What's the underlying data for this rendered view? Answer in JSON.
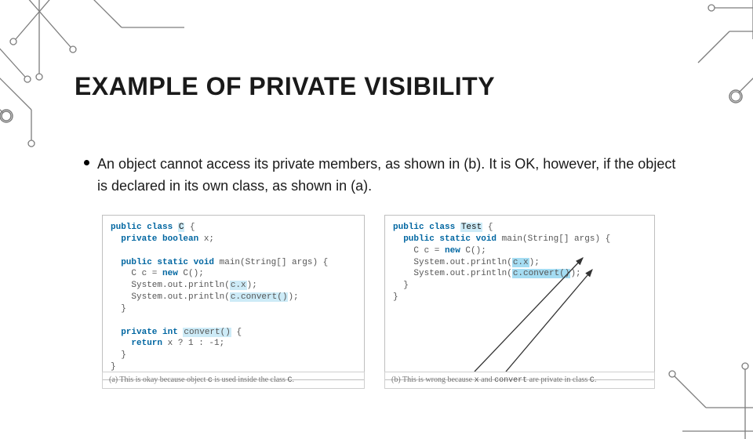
{
  "title": "EXAMPLE OF PRIVATE VISIBILITY",
  "bullet": "An object cannot access its private members, as shown in (b). It is OK, however, if the object is declared in its own class, as shown in (a).",
  "code_a": {
    "lines": [
      {
        "t": "public class ",
        "k": true,
        "after": "C",
        "cls": true,
        "rest": " {"
      },
      {
        "indent": 1,
        "t": "private boolean ",
        "k": true,
        "after": "x;"
      },
      {
        "blank": true
      },
      {
        "indent": 1,
        "t": "public static void ",
        "k": true,
        "after": "main(String[] args) {"
      },
      {
        "indent": 2,
        "plain": "C c = ",
        "k2": "new ",
        "after2": "C();"
      },
      {
        "indent": 2,
        "plain": "System.out.println(",
        "hl": "c.x",
        "rest": ");"
      },
      {
        "indent": 2,
        "plain": "System.out.println(",
        "hl": "c.convert()",
        "rest": ");"
      },
      {
        "indent": 1,
        "plain": "}"
      },
      {
        "blank": true
      },
      {
        "indent": 1,
        "t": "private int ",
        "k": true,
        "hl": "convert()",
        "rest": " {"
      },
      {
        "indent": 2,
        "t": "return ",
        "k": true,
        "after": "x ? 1 : -1;"
      },
      {
        "indent": 1,
        "plain": "}"
      },
      {
        "plain": "}"
      }
    ]
  },
  "code_b": {
    "lines": [
      {
        "t": "public class ",
        "k": true,
        "after": "Test",
        "cls": true,
        "rest": " {"
      },
      {
        "indent": 1,
        "t": "public static void ",
        "k": true,
        "after": "main(String[] args) {"
      },
      {
        "indent": 2,
        "plain": "C c = ",
        "k2": "new ",
        "after2": "C();"
      },
      {
        "indent": 2,
        "plain": "System.out.println(",
        "hlerr": "c.x",
        "rest": ");"
      },
      {
        "indent": 2,
        "plain": "System.out.println(",
        "hlerr": "c.convert()",
        "rest": ");"
      },
      {
        "indent": 1,
        "plain": "}"
      },
      {
        "plain": "}"
      }
    ]
  },
  "caption_a": {
    "pre": "(a) This is okay because object ",
    "mono1": "c",
    "mid": " is used inside the class ",
    "mono2": "C",
    "post": "."
  },
  "caption_b": {
    "pre": "(b) This is wrong because ",
    "mono1": "x",
    "mid": " and ",
    "mono2": "convert",
    "mid2": " are private in class ",
    "mono3": "C",
    "post": "."
  }
}
